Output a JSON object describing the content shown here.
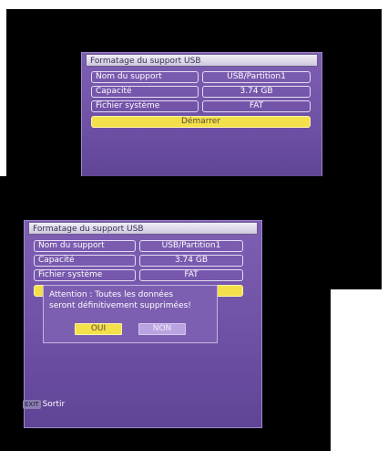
{
  "format_screen": {
    "title": "Formatage du support USB",
    "rows": [
      {
        "label": "Nom du support",
        "value": "USB/Partition1"
      },
      {
        "label": "Capacité",
        "value": "3.74 GB"
      },
      {
        "label": "Fichier système",
        "value": "FAT"
      }
    ],
    "start_label": "Démarrer"
  },
  "confirm_screen": {
    "title": "Formatage du support USB",
    "rows": [
      {
        "label": "Nom du support",
        "value": "USB/Partition1"
      },
      {
        "label": "Capacité",
        "value": "3.74 GB"
      },
      {
        "label": "Fichier système",
        "value": "FAT"
      }
    ],
    "dialog": {
      "line1": "Attention : Toutes les données",
      "line2": "seront définitivement supprimées!",
      "yes_label": "OUI",
      "no_label": "NON"
    },
    "footer": {
      "key_label": "EXIT",
      "action_label": "Sortir"
    }
  },
  "colors": {
    "panel": "#6d4fa4",
    "highlight": "#f3e04a",
    "inactive_button": "#b9a3e0"
  }
}
